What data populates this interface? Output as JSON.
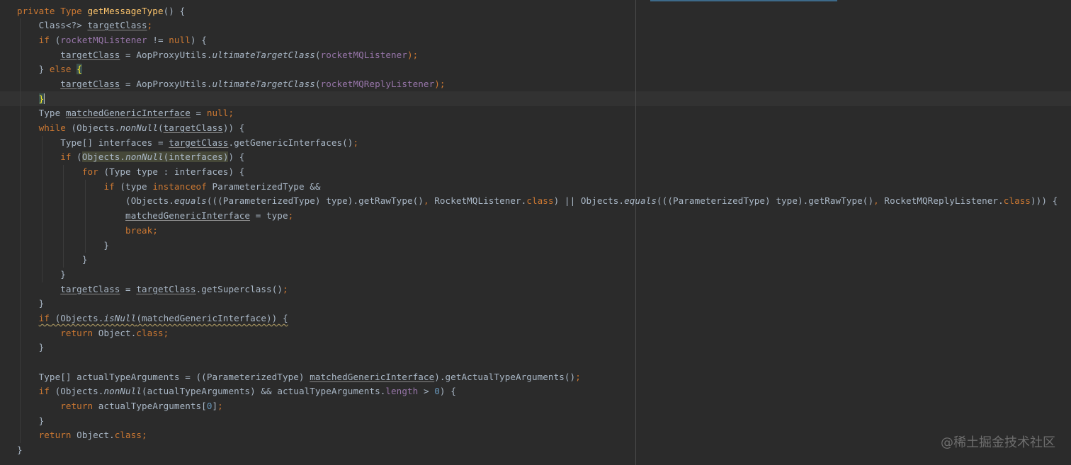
{
  "colors": {
    "background": "#2b2b2b",
    "keyword": "#cc7832",
    "method_declaration": "#ffc66d",
    "field": "#9876aa",
    "number": "#6897bb",
    "default_text": "#a9b7c6"
  },
  "code_lines": [
    [
      {
        "t": "private Type ",
        "k": "kw"
      },
      {
        "t": "getMessageType",
        "k": "fn"
      },
      {
        "t": "() {",
        "k": ""
      }
    ],
    [
      {
        "t": "    Class<?> ",
        "k": ""
      },
      {
        "t": "targetClass",
        "k": "und"
      },
      {
        "t": ";",
        "k": "kw"
      }
    ],
    [
      {
        "t": "    ",
        "k": ""
      },
      {
        "t": "if",
        "k": "kw"
      },
      {
        "t": " (",
        "k": ""
      },
      {
        "t": "rocketMQListener",
        "k": "fld"
      },
      {
        "t": " != ",
        "k": ""
      },
      {
        "t": "null",
        "k": "kw"
      },
      {
        "t": ") {",
        "k": ""
      }
    ],
    [
      {
        "t": "        ",
        "k": ""
      },
      {
        "t": "targetClass",
        "k": "und"
      },
      {
        "t": " = AopProxyUtils.",
        "k": ""
      },
      {
        "t": "ultimateTargetClass",
        "k": "it"
      },
      {
        "t": "(",
        "k": ""
      },
      {
        "t": "rocketMQListener",
        "k": "fld"
      },
      {
        "t": ");",
        "k": "kw"
      }
    ],
    [
      {
        "t": "    } ",
        "k": ""
      },
      {
        "t": "else",
        "k": "kw"
      },
      {
        "t": " ",
        "k": ""
      },
      {
        "t": "{",
        "k": "bm"
      }
    ],
    [
      {
        "t": "        ",
        "k": ""
      },
      {
        "t": "targetClass",
        "k": "und"
      },
      {
        "t": " = AopProxyUtils.",
        "k": ""
      },
      {
        "t": "ultimateTargetClass",
        "k": "it"
      },
      {
        "t": "(",
        "k": ""
      },
      {
        "t": "rocketMQReplyListener",
        "k": "fld"
      },
      {
        "t": ");",
        "k": "kw"
      }
    ],
    [
      {
        "t": "    ",
        "k": ""
      },
      {
        "t": "}",
        "k": "bmc"
      }
    ],
    [
      {
        "t": "    Type ",
        "k": ""
      },
      {
        "t": "matchedGenericInterface",
        "k": "und"
      },
      {
        "t": " = ",
        "k": ""
      },
      {
        "t": "null",
        "k": "kw"
      },
      {
        "t": ";",
        "k": "kw"
      }
    ],
    [
      {
        "t": "    ",
        "k": ""
      },
      {
        "t": "while",
        "k": "kw"
      },
      {
        "t": " (Objects.",
        "k": ""
      },
      {
        "t": "nonNull",
        "k": "it"
      },
      {
        "t": "(",
        "k": ""
      },
      {
        "t": "targetClass",
        "k": "und"
      },
      {
        "t": ")) {",
        "k": ""
      }
    ],
    [
      {
        "t": "        Type[] interfaces = ",
        "k": ""
      },
      {
        "t": "targetClass",
        "k": "und"
      },
      {
        "t": ".getGenericInterfaces()",
        "k": ""
      },
      {
        "t": ";",
        "k": "kw"
      }
    ],
    [
      {
        "t": "        ",
        "k": ""
      },
      {
        "t": "if",
        "k": "kw"
      },
      {
        "t": " (",
        "k": ""
      },
      {
        "t": "Objects.",
        "k": "hl"
      },
      {
        "t": "nonNull",
        "k": "hlit"
      },
      {
        "t": "(interfaces)",
        "k": "hl"
      },
      {
        "t": ") {",
        "k": ""
      }
    ],
    [
      {
        "t": "            ",
        "k": ""
      },
      {
        "t": "for",
        "k": "kw"
      },
      {
        "t": " (Type type : interfaces) {",
        "k": ""
      }
    ],
    [
      {
        "t": "                ",
        "k": ""
      },
      {
        "t": "if",
        "k": "kw"
      },
      {
        "t": " (type ",
        "k": ""
      },
      {
        "t": "instanceof",
        "k": "kw"
      },
      {
        "t": " ParameterizedType &&",
        "k": ""
      }
    ],
    [
      {
        "t": "                    (Objects.",
        "k": ""
      },
      {
        "t": "equals",
        "k": "it"
      },
      {
        "t": "(((ParameterizedType) type).getRawType()",
        "k": ""
      },
      {
        "t": ",",
        "k": "kw"
      },
      {
        "t": " RocketMQListener.",
        "k": ""
      },
      {
        "t": "class",
        "k": "kw"
      },
      {
        "t": ") || Objects.",
        "k": ""
      },
      {
        "t": "equals",
        "k": "it"
      },
      {
        "t": "(((ParameterizedType) type).getRawType()",
        "k": ""
      },
      {
        "t": ",",
        "k": "kw"
      },
      {
        "t": " RocketMQReplyListener.",
        "k": ""
      },
      {
        "t": "class",
        "k": "kw"
      },
      {
        "t": "))) {",
        "k": ""
      }
    ],
    [
      {
        "t": "                    ",
        "k": ""
      },
      {
        "t": "matchedGenericInterface",
        "k": "und"
      },
      {
        "t": " = type",
        "k": ""
      },
      {
        "t": ";",
        "k": "kw"
      }
    ],
    [
      {
        "t": "                    ",
        "k": ""
      },
      {
        "t": "break;",
        "k": "kw"
      }
    ],
    [
      {
        "t": "                }",
        "k": ""
      }
    ],
    [
      {
        "t": "            }",
        "k": ""
      }
    ],
    [
      {
        "t": "        }",
        "k": ""
      }
    ],
    [
      {
        "t": "        ",
        "k": ""
      },
      {
        "t": "targetClass",
        "k": "und"
      },
      {
        "t": " = ",
        "k": ""
      },
      {
        "t": "targetClass",
        "k": "und"
      },
      {
        "t": ".getSuperclass()",
        "k": ""
      },
      {
        "t": ";",
        "k": "kw"
      }
    ],
    [
      {
        "t": "    }",
        "k": ""
      }
    ],
    [
      {
        "t": "    ",
        "k": ""
      },
      {
        "t": "if",
        "k": "kwwavy"
      },
      {
        "t": " (Objects.",
        "k": "wavy"
      },
      {
        "t": "isNull",
        "k": "itwavy"
      },
      {
        "t": "(matchedGenericInterface)) {",
        "k": "wavy"
      }
    ],
    [
      {
        "t": "        ",
        "k": ""
      },
      {
        "t": "return",
        "k": "kw"
      },
      {
        "t": " Object.",
        "k": ""
      },
      {
        "t": "class",
        "k": "kw"
      },
      {
        "t": ";",
        "k": "kw"
      }
    ],
    [
      {
        "t": "    }",
        "k": ""
      }
    ],
    [
      {
        "t": "",
        "k": ""
      }
    ],
    [
      {
        "t": "    Type[] actualTypeArguments = ((ParameterizedType) ",
        "k": ""
      },
      {
        "t": "matchedGenericInterface",
        "k": "und"
      },
      {
        "t": ").getActualTypeArguments()",
        "k": ""
      },
      {
        "t": ";",
        "k": "kw"
      }
    ],
    [
      {
        "t": "    ",
        "k": ""
      },
      {
        "t": "if",
        "k": "kw"
      },
      {
        "t": " (Objects.",
        "k": ""
      },
      {
        "t": "nonNull",
        "k": "it"
      },
      {
        "t": "(actualTypeArguments) && actualTypeArguments.",
        "k": ""
      },
      {
        "t": "length",
        "k": "fld"
      },
      {
        "t": " > ",
        "k": ""
      },
      {
        "t": "0",
        "k": "num"
      },
      {
        "t": ") {",
        "k": ""
      }
    ],
    [
      {
        "t": "        ",
        "k": ""
      },
      {
        "t": "return",
        "k": "kw"
      },
      {
        "t": " actualTypeArguments[",
        "k": ""
      },
      {
        "t": "0",
        "k": "num"
      },
      {
        "t": "]",
        "k": ""
      },
      {
        "t": ";",
        "k": "kw"
      }
    ],
    [
      {
        "t": "    }",
        "k": ""
      }
    ],
    [
      {
        "t": "    ",
        "k": ""
      },
      {
        "t": "return",
        "k": "kw"
      },
      {
        "t": " Object.",
        "k": ""
      },
      {
        "t": "class",
        "k": "kw"
      },
      {
        "t": ";",
        "k": "kw"
      }
    ],
    [
      {
        "t": "}",
        "k": ""
      }
    ]
  ],
  "watermark": "@稀土掘金技术社区"
}
